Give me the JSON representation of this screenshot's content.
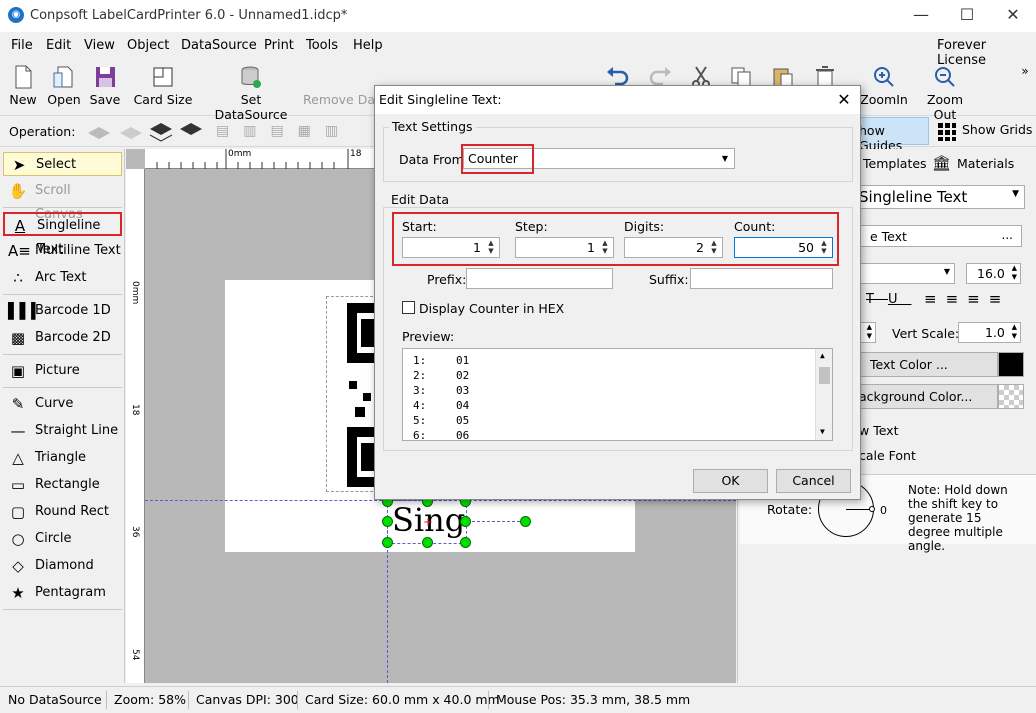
{
  "window": {
    "title": "Conpsoft LabelCardPrinter 6.0 - Unnamed1.idcp*",
    "license": "Forever License"
  },
  "menu": [
    "File",
    "Edit",
    "View",
    "Object",
    "DataSource",
    "Print",
    "Tools",
    "Help"
  ],
  "toolbar": {
    "new": "New",
    "open": "Open",
    "save": "Save",
    "card_size": "Card Size",
    "set_datasource": "Set DataSource",
    "remove_datasource": "Remove Da",
    "zoom_in": "ZoomIn",
    "zoom_out": "Zoom Out"
  },
  "opbar": {
    "label": "Operation:",
    "show_guides": "how Guides",
    "show_grids": "Show Grids"
  },
  "tools": [
    "Select",
    "Scroll Canvas",
    "Singleline Text",
    "Multiline Text",
    "Arc Text",
    "Barcode 1D",
    "Barcode 2D",
    "Picture",
    "Curve",
    "Straight Line",
    "Triangle",
    "Rectangle",
    "Round Rect",
    "Circle",
    "Diamond",
    "Pentagram"
  ],
  "ruler": {
    "h0": "0mm",
    "h18": "18",
    "v0": "0mm",
    "v18": "18",
    "v36": "36",
    "v54": "54"
  },
  "canvas": {
    "text": "Sing"
  },
  "right": {
    "tab_templates": "Templates",
    "tab_materials": "Materials",
    "object_type": "Singleline Text",
    "text_btn": "e Text",
    "font_size": "16.0",
    "vert_scale_label": "Vert Scale:",
    "vert_scale": "1.0",
    "text_color": "Text Color ...",
    "bg_color": "ackground Color...",
    "wtext": "w Text",
    "scale_font": "cale Font",
    "rotate_label": "Rotate:",
    "rotate_value": "0",
    "note": "Note: Hold down the shift key to generate 15 degree multiple angle."
  },
  "status": {
    "datasource": "No DataSource",
    "zoom": "Zoom: 58%",
    "dpi": "Canvas DPI: 300",
    "card": "Card Size: 60.0 mm x 40.0 mm",
    "mouse": "Mouse Pos: 35.3 mm, 38.5 mm"
  },
  "dialog": {
    "title": "Edit Singleline Text:",
    "text_settings": "Text Settings",
    "data_from_label": "Data From:",
    "data_from": "Counter",
    "edit_data": "Edit Data",
    "start_label": "Start:",
    "start": "1",
    "step_label": "Step:",
    "step": "1",
    "digits_label": "Digits:",
    "digits": "2",
    "count_label": "Count:",
    "count": "50",
    "prefix_label": "Prefix:",
    "suffix_label": "Suffix:",
    "hex_label": "Display Counter in HEX",
    "preview_label": "Preview:",
    "preview_rows": [
      [
        "1:",
        "01"
      ],
      [
        "2:",
        "02"
      ],
      [
        "3:",
        "03"
      ],
      [
        "4:",
        "04"
      ],
      [
        "5:",
        "05"
      ],
      [
        "6:",
        "06"
      ]
    ],
    "ok": "OK",
    "cancel": "Cancel"
  },
  "colors": {
    "highlight": "#d9262c",
    "selected_tool": "#fffbd6",
    "handle": "#00e000"
  }
}
